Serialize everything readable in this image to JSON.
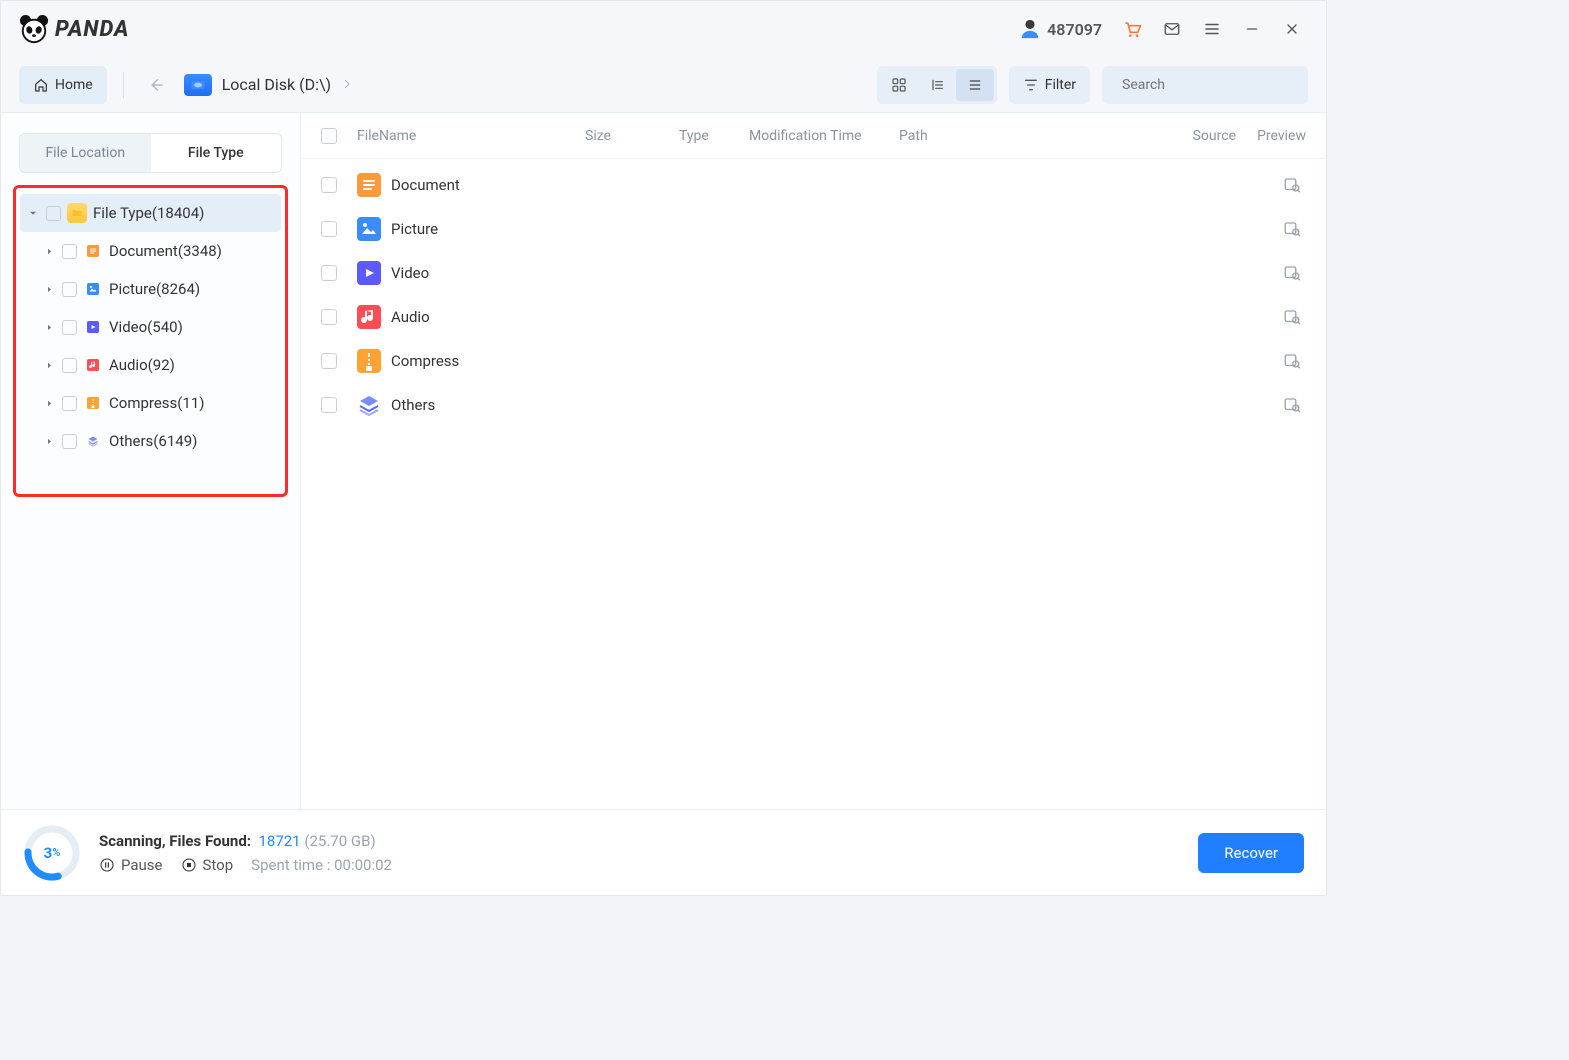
{
  "app_name": "PANDA",
  "titlebar": {
    "user_id": "487097"
  },
  "toolbar": {
    "home_label": "Home",
    "breadcrumb_label": "Local Disk (D:\\)",
    "filter_label": "Filter",
    "search_placeholder": "Search"
  },
  "sidebar": {
    "tabs": {
      "location": "File Location",
      "type": "File Type"
    },
    "root_label": "File Type(18404)",
    "items": [
      {
        "label": "Document(3348)",
        "icon": "doc"
      },
      {
        "label": "Picture(8264)",
        "icon": "pic"
      },
      {
        "label": "Video(540)",
        "icon": "vid"
      },
      {
        "label": "Audio(92)",
        "icon": "aud"
      },
      {
        "label": "Compress(11)",
        "icon": "zip"
      },
      {
        "label": "Others(6149)",
        "icon": "oth"
      }
    ]
  },
  "columns": {
    "name": "FileName",
    "size": "Size",
    "type": "Type",
    "mod": "Modification Time",
    "path": "Path",
    "source": "Source",
    "preview": "Preview"
  },
  "rows": [
    {
      "label": "Document",
      "icon": "doc"
    },
    {
      "label": "Picture",
      "icon": "pic"
    },
    {
      "label": "Video",
      "icon": "vid"
    },
    {
      "label": "Audio",
      "icon": "aud"
    },
    {
      "label": "Compress",
      "icon": "zip"
    },
    {
      "label": "Others",
      "icon": "oth"
    }
  ],
  "footer": {
    "progress": "3",
    "progress_suffix": "%",
    "scanning_label": "Scanning, Files Found:",
    "found_count": "18721",
    "total_size": "(25.70 GB)",
    "pause_label": "Pause",
    "stop_label": "Stop",
    "spent_label": "Spent time : 00:00:02",
    "recover_label": "Recover"
  }
}
